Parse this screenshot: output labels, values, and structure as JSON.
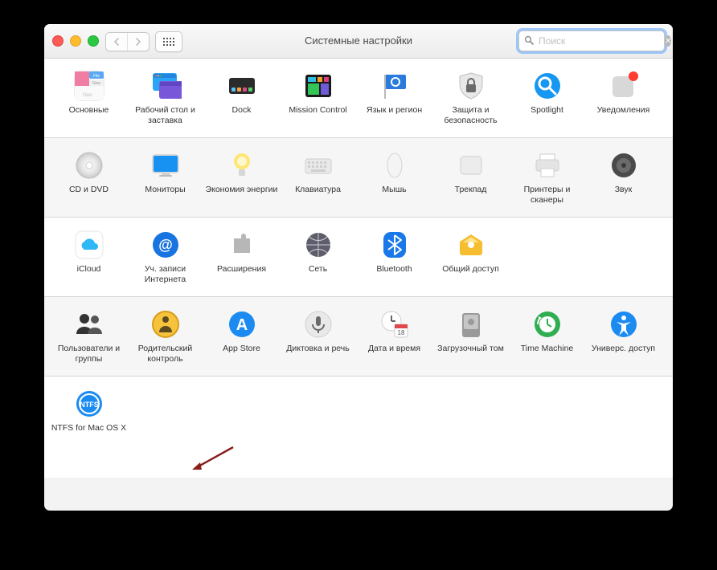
{
  "window": {
    "title": "Системные настройки",
    "search_placeholder": "Поиск"
  },
  "rows": [
    [
      {
        "id": "general",
        "label": "Основные"
      },
      {
        "id": "desktop",
        "label": "Рабочий стол и заставка"
      },
      {
        "id": "dock",
        "label": "Dock"
      },
      {
        "id": "mission-control",
        "label": "Mission Control"
      },
      {
        "id": "language-region",
        "label": "Язык и регион"
      },
      {
        "id": "security",
        "label": "Защита и безопасность"
      },
      {
        "id": "spotlight",
        "label": "Spotlight"
      },
      {
        "id": "notifications",
        "label": "Уведомления"
      }
    ],
    [
      {
        "id": "cds-dvds",
        "label": "CD и DVD"
      },
      {
        "id": "displays",
        "label": "Мониторы"
      },
      {
        "id": "energy-saver",
        "label": "Экономия энергии"
      },
      {
        "id": "keyboard",
        "label": "Клавиатура"
      },
      {
        "id": "mouse",
        "label": "Мышь"
      },
      {
        "id": "trackpad",
        "label": "Трекпад"
      },
      {
        "id": "printers-scanners",
        "label": "Принтеры и сканеры"
      },
      {
        "id": "sound",
        "label": "Звук"
      }
    ],
    [
      {
        "id": "icloud",
        "label": "iCloud"
      },
      {
        "id": "internet-accounts",
        "label": "Уч. записи Интернета"
      },
      {
        "id": "extensions",
        "label": "Расширения"
      },
      {
        "id": "network",
        "label": "Сеть"
      },
      {
        "id": "bluetooth",
        "label": "Bluetooth"
      },
      {
        "id": "sharing",
        "label": "Общий доступ"
      }
    ],
    [
      {
        "id": "users-groups",
        "label": "Пользователи и группы"
      },
      {
        "id": "parental-controls",
        "label": "Родительский контроль"
      },
      {
        "id": "app-store",
        "label": "App Store"
      },
      {
        "id": "dictation-speech",
        "label": "Диктовка и речь"
      },
      {
        "id": "date-time",
        "label": "Дата и время"
      },
      {
        "id": "startup-disk",
        "label": "Загрузочный том"
      },
      {
        "id": "time-machine",
        "label": "Time Machine"
      },
      {
        "id": "accessibility",
        "label": "Универс. доступ"
      }
    ],
    [
      {
        "id": "ntfs-for-mac",
        "label": "NTFS for Mac OS X"
      }
    ]
  ]
}
